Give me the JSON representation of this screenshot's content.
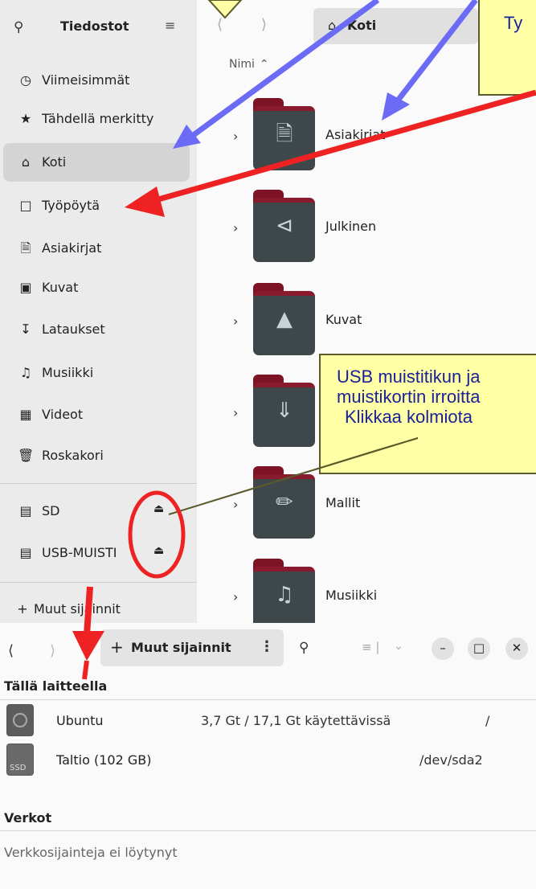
{
  "sidebar": {
    "title": "Tiedostot",
    "items": [
      {
        "label": "Viimeisimmät",
        "icon": "clock-icon"
      },
      {
        "label": "Tähdellä merkitty",
        "icon": "star-icon"
      },
      {
        "label": "Koti",
        "icon": "home-icon"
      },
      {
        "label": "Työpöytä",
        "icon": "desktop-icon"
      },
      {
        "label": "Asiakirjat",
        "icon": "document-icon"
      },
      {
        "label": "Kuvat",
        "icon": "pictures-icon"
      },
      {
        "label": "Lataukset",
        "icon": "download-icon"
      },
      {
        "label": "Musiikki",
        "icon": "music-icon"
      },
      {
        "label": "Videot",
        "icon": "video-icon"
      },
      {
        "label": "Roskakori",
        "icon": "trash-icon"
      },
      {
        "label": "SD",
        "icon": "drive-icon"
      },
      {
        "label": "USB-MUISTI",
        "icon": "drive-icon"
      },
      {
        "label": "Muut sijainnit",
        "icon": "plus-icon"
      }
    ]
  },
  "pathbar": {
    "current": "Koti"
  },
  "columns": {
    "name": "Nimi"
  },
  "files": [
    {
      "name": "Asiakirjat",
      "icon": "document-icon"
    },
    {
      "name": "Julkinen",
      "icon": "share-icon"
    },
    {
      "name": "Kuvat",
      "icon": "pictures-icon"
    },
    {
      "name": "",
      "icon": "download-icon"
    },
    {
      "name": "Mallit",
      "icon": "templates-icon"
    },
    {
      "name": "Musiikki",
      "icon": "music-icon"
    }
  ],
  "annotations": {
    "callout_top_right": "Ty",
    "usb_callout": {
      "line1": "USB muistitikun ja",
      "line2": "muistikortin irroitta",
      "line3": "Klikkaa kolmiota"
    },
    "colors": {
      "arrow_blue": "#6b6bf5",
      "arrow_red": "#ee2222",
      "callout_bg": "#ffffa6",
      "callout_text": "#1a2299"
    }
  },
  "bottom": {
    "path_label": "Muut sijainnit",
    "section_device": "Tällä laitteella",
    "devices": [
      {
        "name": "Ubuntu",
        "info": "3,7 Gt / 17,1 Gt käytettävissä",
        "mount": "/"
      },
      {
        "name": "Taltio (102 GB)",
        "info": "",
        "mount": "/dev/sda2",
        "badge": "SSD"
      }
    ],
    "section_network": "Verkot",
    "network_empty": "Verkkosijainteja ei löytynyt"
  }
}
